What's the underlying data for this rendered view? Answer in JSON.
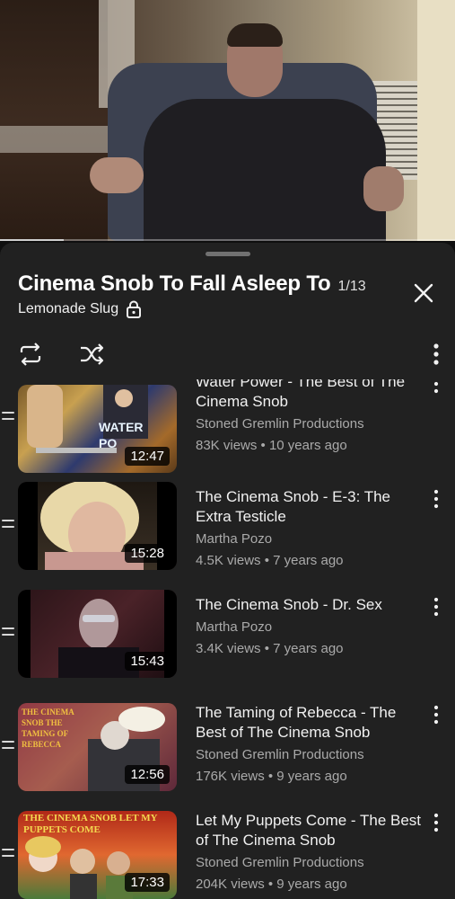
{
  "player": {
    "progress_fraction": 0.14
  },
  "playlist": {
    "title": "Cinema Snob To Fall Asleep To",
    "position": "1/13",
    "owner": "Lemonade Slug"
  },
  "icons": {
    "lock": "lock-icon",
    "close": "close-icon",
    "loop": "loop-icon",
    "shuffle": "shuffle-icon",
    "more": "more-vertical-icon",
    "drag": "drag-handle-icon"
  },
  "videos": [
    {
      "title": "Water Power - The Best of The Cinema Snob",
      "channel": "Stoned Gremlin Productions",
      "stats": "83K views • 10 years ago",
      "duration": "12:47",
      "thumb_text": "WATER PO"
    },
    {
      "title": "The Cinema Snob - E-3: The Extra Testicle",
      "channel": "Martha Pozo",
      "stats": "4.5K views • 7 years ago",
      "duration": "15:28"
    },
    {
      "title": "The Cinema Snob - Dr. Sex",
      "channel": "Martha Pozo",
      "stats": "3.4K views • 7 years ago",
      "duration": "15:43"
    },
    {
      "title": "The Taming of Rebecca - The Best of The Cinema Snob",
      "channel": "Stoned Gremlin Productions",
      "stats": "176K views • 9 years ago",
      "duration": "12:56",
      "thumb_text": "THE CINEMA SNOB THE TAMING OF REBECCA"
    },
    {
      "title": "Let My Puppets Come - The Best of The Cinema Snob",
      "channel": "Stoned Gremlin Productions",
      "stats": "204K views • 9 years ago",
      "duration": "17:33",
      "thumb_text": "THE CINEMA SNOB LET MY PUPPETS COME"
    }
  ]
}
